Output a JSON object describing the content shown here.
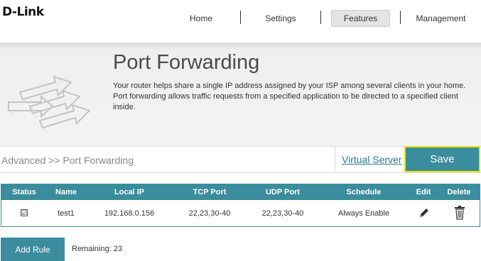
{
  "brand": {
    "logo_text": "D-Link"
  },
  "nav": {
    "home": "Home",
    "settings": "Settings",
    "features": "Features",
    "management": "Management",
    "active": "Features"
  },
  "banner": {
    "title": "Port Forwarding",
    "description": "Your router helps share a single IP address assigned by your ISP among several clients in your home. Port forwarding allows traffic requests from a specified application to be directed to a specified client inside."
  },
  "breadcrumb": "Advanced >> Port Forwarding",
  "actions": {
    "virtual_server_label": "Virtual Server",
    "save_label": "Save"
  },
  "table": {
    "headers": {
      "status": "Status",
      "name": "Name",
      "local_ip": "Local IP",
      "tcp_port": "TCP Port",
      "udp_port": "UDP Port",
      "schedule": "Schedule",
      "edit": "Edit",
      "delete": "Delete"
    },
    "rows": [
      {
        "status_checked": true,
        "status_mark": "☑",
        "name": "test1",
        "local_ip": "192.168.0.156",
        "tcp_port": "22,23,30-40",
        "udp_port": "22,23,30-40",
        "schedule": "Always Enable"
      }
    ]
  },
  "footer": {
    "add_rule_label": "Add Rule",
    "remaining_text": "Remaining: 23"
  },
  "colors": {
    "accent": "#3b8c9d",
    "save_focus_border": "#e6e600",
    "link": "#2a7a8c"
  },
  "icons": {
    "edit": "pencil-icon",
    "delete": "trash-icon",
    "banner": "arrows-illustration-icon"
  }
}
